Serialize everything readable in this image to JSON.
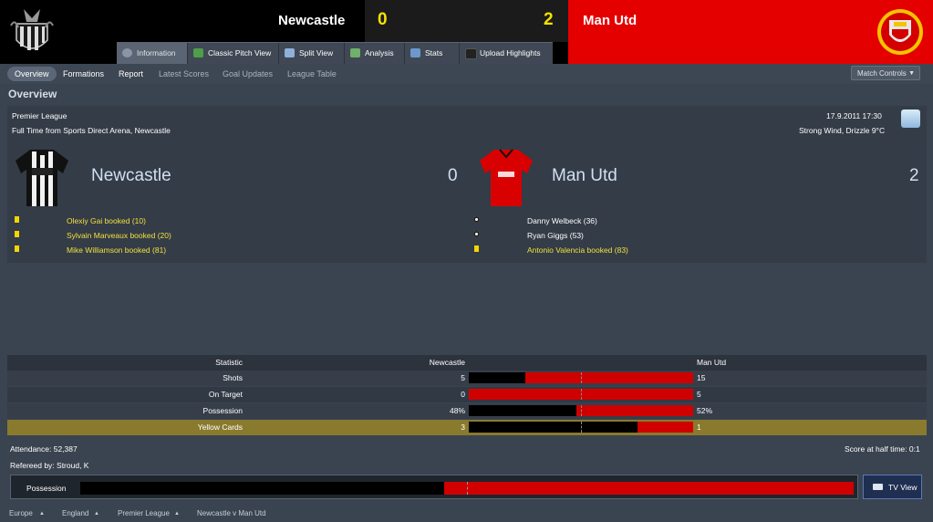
{
  "header": {
    "home_team": "Newcastle",
    "away_team": "Man Utd",
    "home_score": "0",
    "away_score": "2",
    "colors": {
      "home_bg": "#000000",
      "away_bg": "#e50000",
      "score": "#f5e100"
    }
  },
  "tabs": [
    {
      "label": "Information",
      "icon": "info-icon",
      "active": true
    },
    {
      "label": "Classic Pitch View",
      "icon": "pitch-icon"
    },
    {
      "label": "Split View",
      "icon": "split-view-icon"
    },
    {
      "label": "Analysis",
      "icon": "analysis-icon"
    },
    {
      "label": "Stats",
      "icon": "stats-icon"
    },
    {
      "label": "Upload Highlights",
      "icon": "video-icon"
    }
  ],
  "subnav": {
    "items": [
      "Overview",
      "Formations",
      "Report",
      "Latest Scores",
      "Goal Updates",
      "League Table"
    ],
    "match_controls": "Match Controls"
  },
  "page_title": "Overview",
  "info": {
    "competition": "Premier League",
    "datetime": "17.9.2011 17:30",
    "result_text": "Full Time from Sports Direct Arena, Newcastle",
    "weather": "Strong Wind, Drizzle 9°C",
    "home_team": "Newcastle",
    "home_score": "0",
    "away_team": "Man Utd",
    "away_score": "2",
    "home_events": [
      {
        "text": "Olexiy Gai booked (10)",
        "type": "yellow-card"
      },
      {
        "text": "Sylvain Marveaux booked (20)",
        "type": "yellow-card"
      },
      {
        "text": "Mike Williamson booked (81)",
        "type": "yellow-card"
      }
    ],
    "away_events": [
      {
        "text": "Danny Welbeck (36)",
        "type": "goal"
      },
      {
        "text": "Ryan Giggs (53)",
        "type": "goal"
      },
      {
        "text": "Antonio Valencia booked (83)",
        "type": "yellow-card"
      }
    ]
  },
  "stats": {
    "header": {
      "label": "Statistic",
      "home": "Newcastle",
      "away": "Man Utd"
    },
    "rows": [
      {
        "label": "Shots",
        "home": "5",
        "away": "15",
        "home_share": 0.25
      },
      {
        "label": "On Target",
        "home": "0",
        "away": "5",
        "home_share": 0.0
      },
      {
        "label": "Possession",
        "home": "48%",
        "away": "52%",
        "home_share": 0.48
      },
      {
        "label": "Yellow Cards",
        "home": "3",
        "away": "1",
        "home_share": 0.75,
        "highlighted": true
      }
    ]
  },
  "footer": {
    "attendance": "Attendance: 52,387",
    "half_time": "Score at half time: 0:1",
    "referee": "Refereed by: Stroud, K",
    "possession_label": "Possession",
    "possession_home_share": 0.47,
    "tv_view": "TV View"
  },
  "breadcrumb": [
    "Europe",
    "England",
    "Premier League",
    "Newcastle v Man Utd"
  ]
}
